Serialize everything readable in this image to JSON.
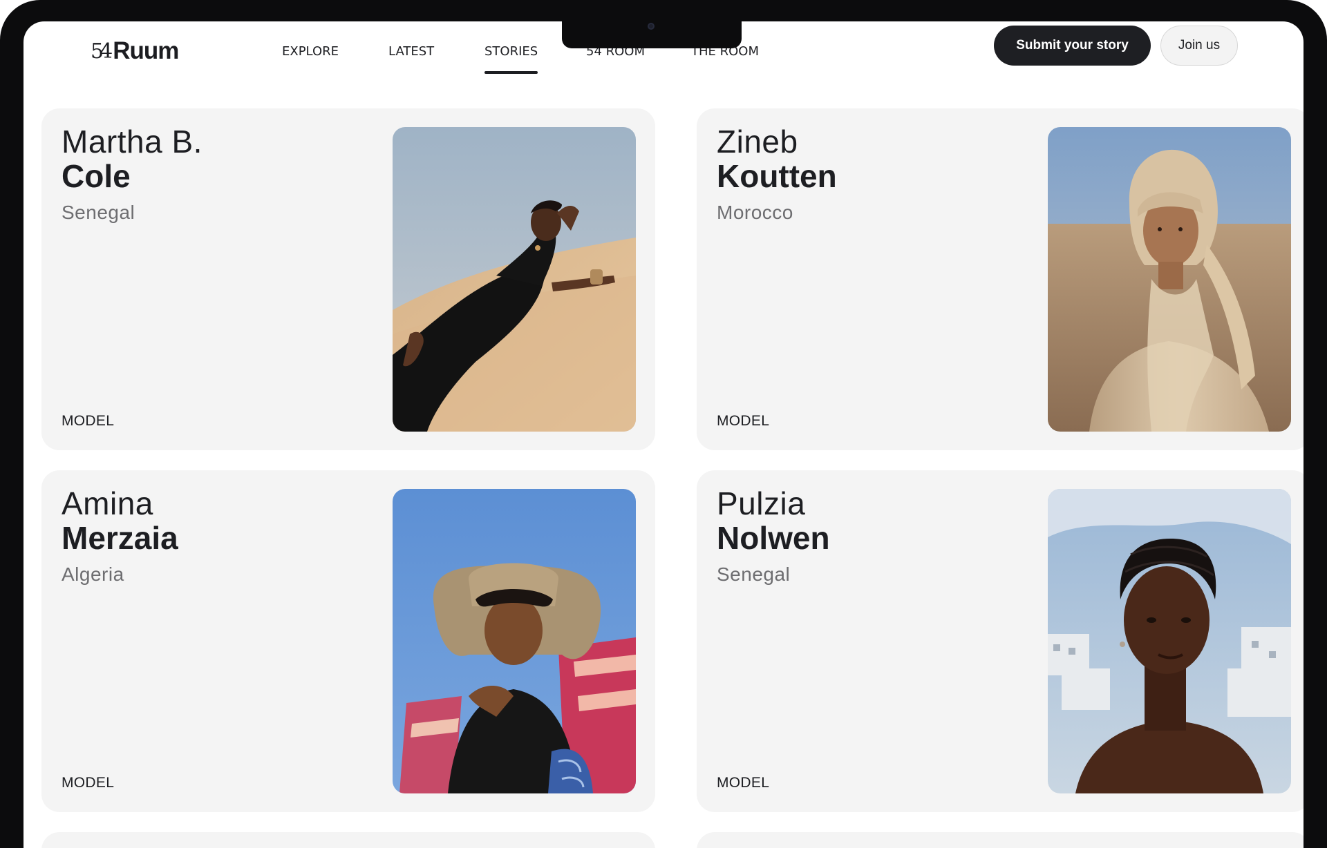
{
  "header": {
    "logo_number": "54",
    "logo_word": "Ruum",
    "nav": [
      {
        "label": "EXPLORE"
      },
      {
        "label": "LATEST"
      },
      {
        "label": "STORIES",
        "active": true
      },
      {
        "label": "54 ROOM"
      },
      {
        "label": "THE ROOM"
      }
    ],
    "submit_label": "Submit your story",
    "join_label": "Join us"
  },
  "cards": [
    {
      "first": "Martha B.",
      "last": "Cole",
      "country": "Senegal",
      "role": "MODEL",
      "photo": "woman-black-dress-lying-on-sand-dune"
    },
    {
      "first": "Zineb",
      "last": "Koutten",
      "country": "Morocco",
      "role": "MODEL",
      "photo": "woman-headscarf-desert-portrait"
    },
    {
      "first": "Amina",
      "last": "Merzaia",
      "country": "Algeria",
      "role": "MODEL",
      "photo": "woman-straw-hat-blue-sky"
    },
    {
      "first": "Pulzia",
      "last": "Nolwen",
      "country": "Senegal",
      "role": "MODEL",
      "photo": "woman-braids-coastal-town"
    }
  ],
  "colors": {
    "bezel": "#0c0c0d",
    "card_bg": "#f4f4f4",
    "text_dark": "#1d1e22",
    "text_muted": "#6d6d70",
    "button_dark": "#1e1f23"
  }
}
